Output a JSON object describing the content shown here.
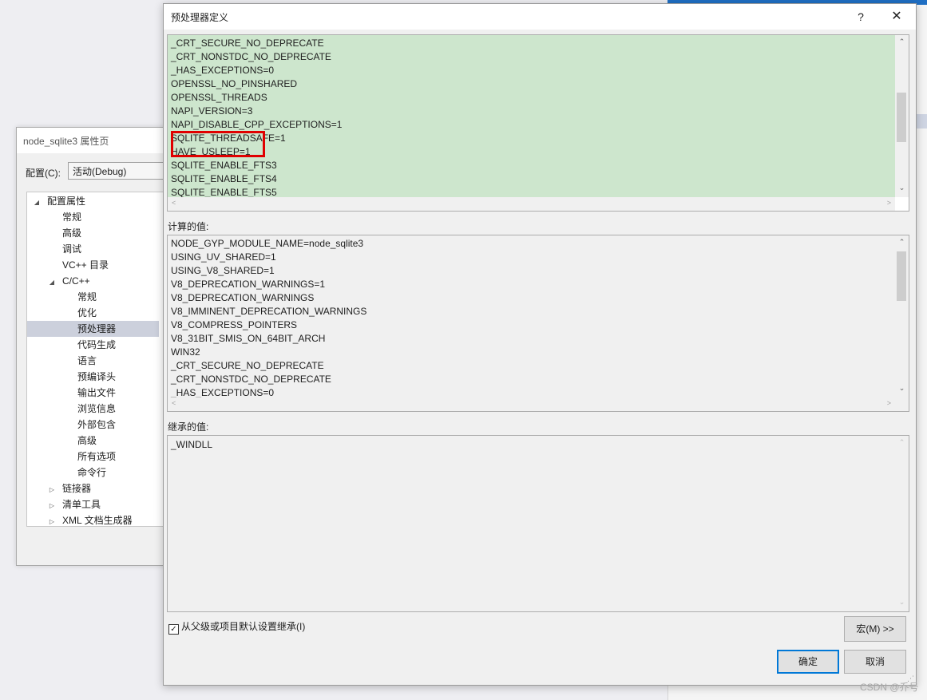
{
  "property_page": {
    "title": "node_sqlite3 属性页",
    "config_label": "配置(C):",
    "config_value": "活动(Debug)",
    "tree": [
      {
        "label": "配置属性",
        "arrow": "◢",
        "indent": 0,
        "selected": false
      },
      {
        "label": "常规",
        "arrow": "",
        "indent": 1,
        "selected": false
      },
      {
        "label": "高级",
        "arrow": "",
        "indent": 1,
        "selected": false
      },
      {
        "label": "调试",
        "arrow": "",
        "indent": 1,
        "selected": false
      },
      {
        "label": "VC++ 目录",
        "arrow": "",
        "indent": 1,
        "selected": false
      },
      {
        "label": "C/C++",
        "arrow": "◢",
        "indent": 1,
        "selected": false
      },
      {
        "label": "常规",
        "arrow": "",
        "indent": 2,
        "selected": false
      },
      {
        "label": "优化",
        "arrow": "",
        "indent": 2,
        "selected": false
      },
      {
        "label": "预处理器",
        "arrow": "",
        "indent": 2,
        "selected": true
      },
      {
        "label": "代码生成",
        "arrow": "",
        "indent": 2,
        "selected": false
      },
      {
        "label": "语言",
        "arrow": "",
        "indent": 2,
        "selected": false
      },
      {
        "label": "预编译头",
        "arrow": "",
        "indent": 2,
        "selected": false
      },
      {
        "label": "输出文件",
        "arrow": "",
        "indent": 2,
        "selected": false
      },
      {
        "label": "浏览信息",
        "arrow": "",
        "indent": 2,
        "selected": false
      },
      {
        "label": "外部包含",
        "arrow": "",
        "indent": 2,
        "selected": false
      },
      {
        "label": "高级",
        "arrow": "",
        "indent": 2,
        "selected": false
      },
      {
        "label": "所有选项",
        "arrow": "",
        "indent": 2,
        "selected": false
      },
      {
        "label": "命令行",
        "arrow": "",
        "indent": 2,
        "selected": false
      },
      {
        "label": "链接器",
        "arrow": "▷",
        "indent": 1,
        "selected": false
      },
      {
        "label": "清单工具",
        "arrow": "▷",
        "indent": 1,
        "selected": false
      },
      {
        "label": "XML 文档生成器",
        "arrow": "▷",
        "indent": 1,
        "selected": false
      }
    ]
  },
  "dialog": {
    "title": "预处理器定义",
    "help_label": "?",
    "close_label": "✕",
    "definitions": [
      "_CRT_SECURE_NO_DEPRECATE",
      "_CRT_NONSTDC_NO_DEPRECATE",
      "_HAS_EXCEPTIONS=0",
      "OPENSSL_NO_PINSHARED",
      "OPENSSL_THREADS",
      "NAPI_VERSION=3",
      "NAPI_DISABLE_CPP_EXCEPTIONS=1",
      "SQLITE_THREADSAFE=1",
      "HAVE_USLEEP=1",
      "SQLITE_ENABLE_FTS3",
      "SQLITE_ENABLE_FTS4",
      "SQLITE_ENABLE_FTS5"
    ],
    "highlighted_index": 5,
    "evaluated_label": "计算的值:",
    "evaluated": [
      "NODE_GYP_MODULE_NAME=node_sqlite3",
      "USING_UV_SHARED=1",
      "USING_V8_SHARED=1",
      "V8_DEPRECATION_WARNINGS=1",
      "V8_DEPRECATION_WARNINGS",
      "V8_IMMINENT_DEPRECATION_WARNINGS",
      "V8_COMPRESS_POINTERS",
      "V8_31BIT_SMIS_ON_64BIT_ARCH",
      "WIN32",
      "_CRT_SECURE_NO_DEPRECATE",
      "_CRT_NONSTDC_NO_DEPRECATE",
      "_HAS_EXCEPTIONS=0"
    ],
    "inherited_label": "继承的值:",
    "inherited": [
      "_WINDLL"
    ],
    "inherit_checkbox_label": "从父级或项目默认设置继承(I)",
    "inherit_checked": true,
    "macros_button": "宏(M) >>",
    "ok_button": "确定",
    "cancel_button": "取消"
  },
  "watermark": "CSDN @乔号",
  "colors": {
    "definitions_bg": "#cde6cd",
    "highlight_border": "#e00000",
    "primary_border": "#0078d7"
  }
}
